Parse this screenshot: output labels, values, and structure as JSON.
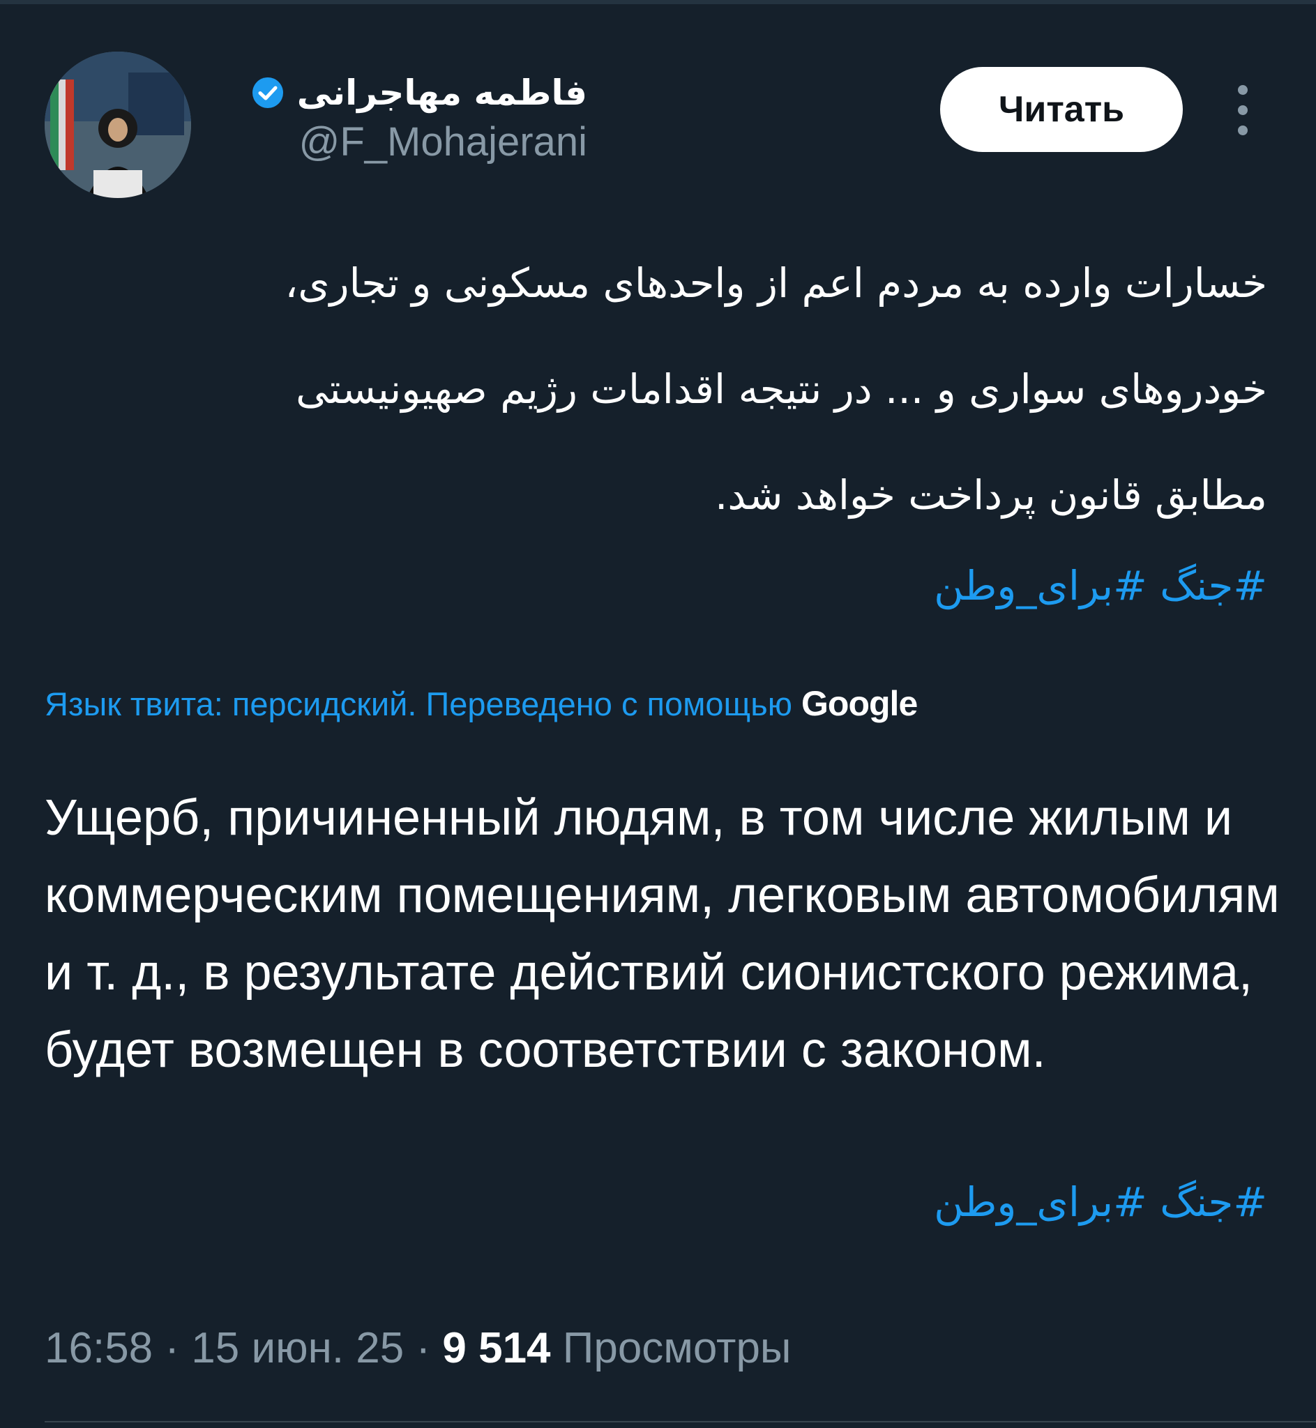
{
  "author": {
    "display_name": "فاطمه مهاجرانی",
    "handle": "@F_Mohajerani",
    "verified": true
  },
  "actions": {
    "follow_label": "Читать"
  },
  "tweet": {
    "original_text": "خسارات وارده به مردم اعم از واحدهای مسکونی و تجاری، خودروهای سواری و ... در نتیجه اقدامات رژیم صهیونیستی مطابق قانون پرداخت خواهد شد.",
    "hashtags": [
      "#جنگ",
      "#برای_وطن"
    ],
    "translation_note": "Язык твита: персидский. Переведено с помощью",
    "translation_provider": "Google",
    "translated_text": "Ущерб, причиненный людям, в том числе жилым и коммерческим помещениям, легковым автомобилям и т. д., в результате действий сионистского режима, будет возмещен в соответствии с законом.",
    "translated_hashtags": [
      "#جنگ",
      "#برای_وطن"
    ]
  },
  "meta": {
    "time": "16:58",
    "separator": "·",
    "date": "15 июн. 25",
    "views_count": "9 514",
    "views_label": "Просмотры"
  },
  "colors": {
    "background": "#15202b",
    "accent": "#1d9bf0",
    "secondary_text": "#8899a6"
  }
}
